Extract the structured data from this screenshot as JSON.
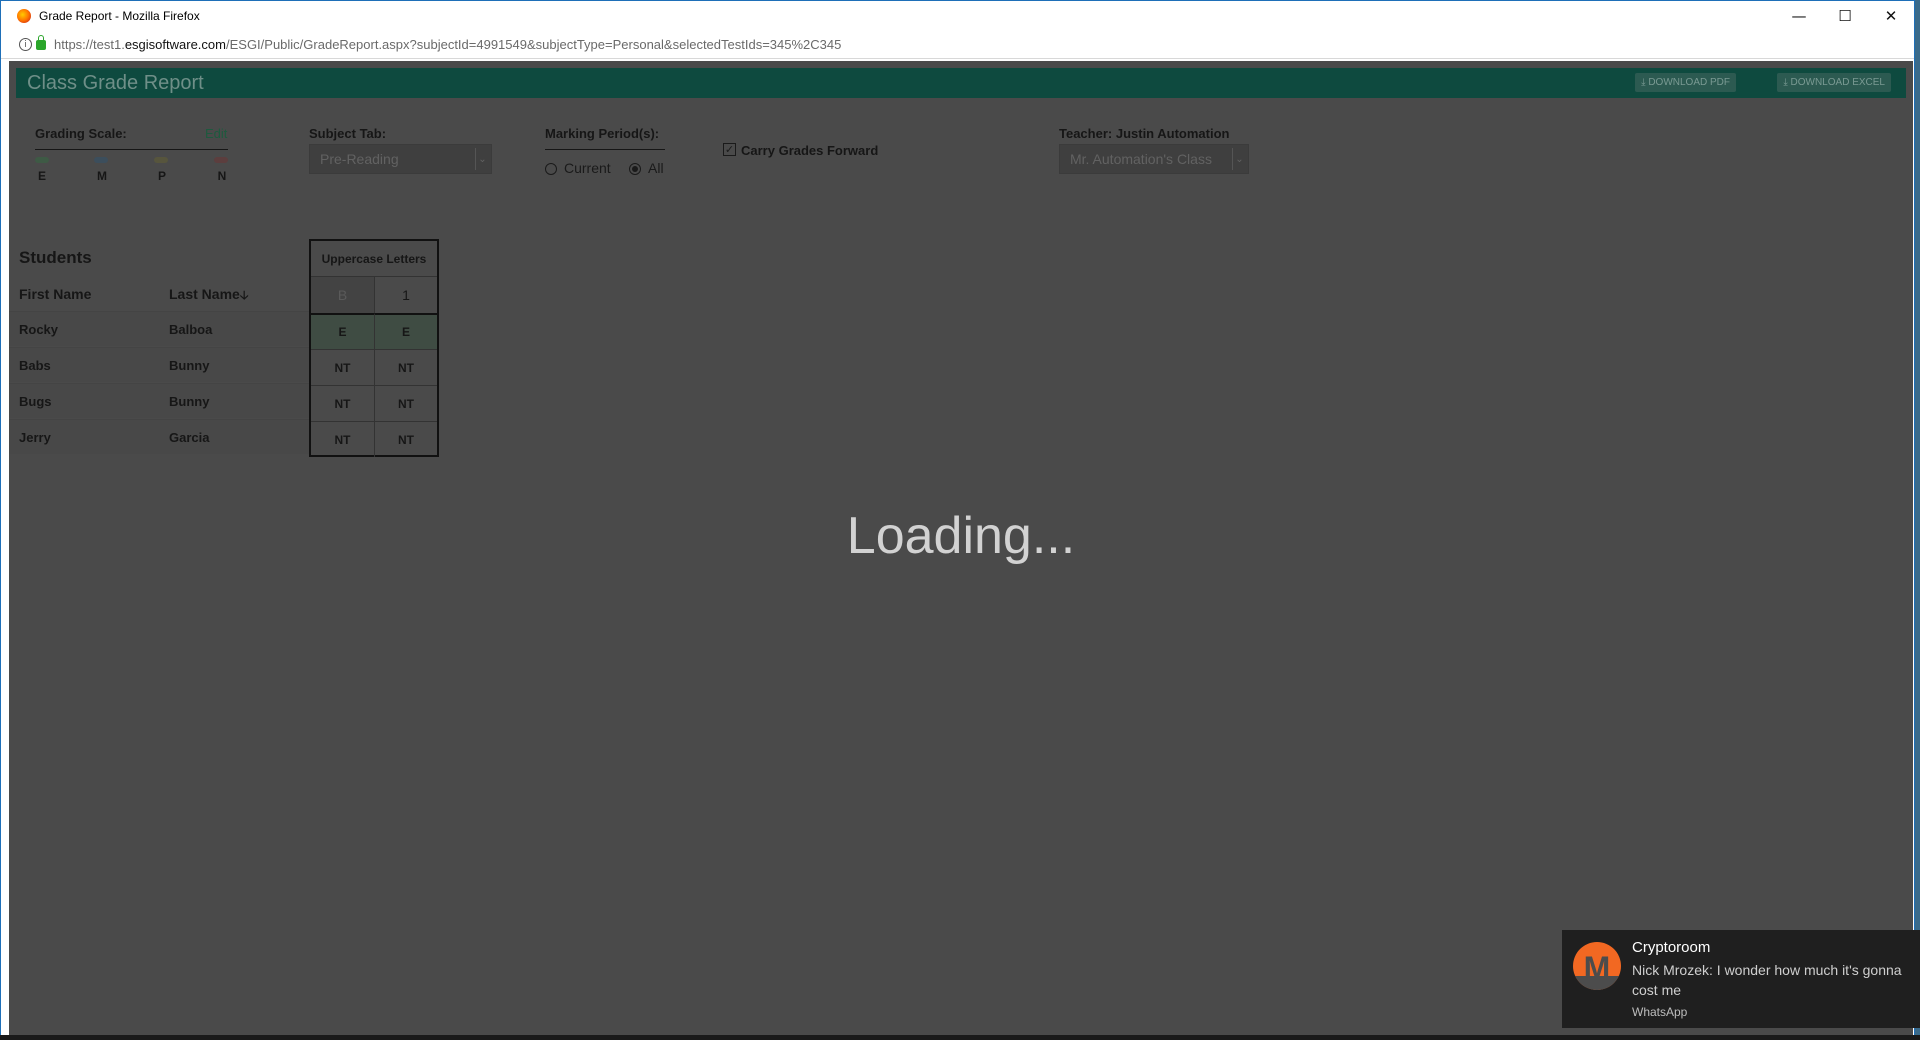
{
  "browser": {
    "window_title": "Grade Report - Mozilla Firefox",
    "url_prefix": "https://test1.",
    "url_domain": "esgisoftware.com",
    "url_path": "/ESGI/Public/GradeReport.aspx?subjectId=4991549&subjectType=Personal&selectedTestIds=345%2C345",
    "controls": {
      "minimize": "—",
      "maximize": "☐",
      "close": "✕"
    }
  },
  "header": {
    "title": "Class Grade Report",
    "download_pdf": "⤓ DOWNLOAD PDF",
    "download_excel": "⤓ DOWNLOAD EXCEL"
  },
  "grading_scale": {
    "label": "Grading Scale:",
    "edit": "Edit",
    "grades": [
      {
        "letter": "E",
        "color": "#3e5a45"
      },
      {
        "letter": "M",
        "color": "#3c4e5c"
      },
      {
        "letter": "P",
        "color": "#57553d"
      },
      {
        "letter": "N",
        "color": "#5c3e3e"
      }
    ]
  },
  "subject_tab": {
    "label": "Subject Tab:",
    "value": "Pre-Reading"
  },
  "marking_period": {
    "label": "Marking Period(s):",
    "options": [
      "Current",
      "All"
    ],
    "selected": "All"
  },
  "carry_forward": {
    "label": "Carry Grades Forward",
    "checked": true
  },
  "teacher": {
    "label": "Teacher: Justin Automation",
    "value": "Mr. Automation's Class"
  },
  "table": {
    "title": "Students",
    "col_first": "First Name",
    "col_last": "Last Name",
    "sort_icon": "🡣",
    "test_name": "Uppercase Letters",
    "sub_cols": [
      "B",
      "1"
    ],
    "rows": [
      {
        "first": "Rocky",
        "last": "Balboa",
        "b": "E",
        "one": "E"
      },
      {
        "first": "Babs",
        "last": "Bunny",
        "b": "NT",
        "one": "NT"
      },
      {
        "first": "Bugs",
        "last": "Bunny",
        "b": "NT",
        "one": "NT"
      },
      {
        "first": "Jerry",
        "last": "Garcia",
        "b": "NT",
        "one": "NT"
      }
    ]
  },
  "overlay": {
    "loading_text": "Loading..."
  },
  "toast": {
    "title": "Cryptoroom",
    "body": "Nick Mrozek: I wonder how much it's gonna cost me",
    "app": "WhatsApp"
  }
}
